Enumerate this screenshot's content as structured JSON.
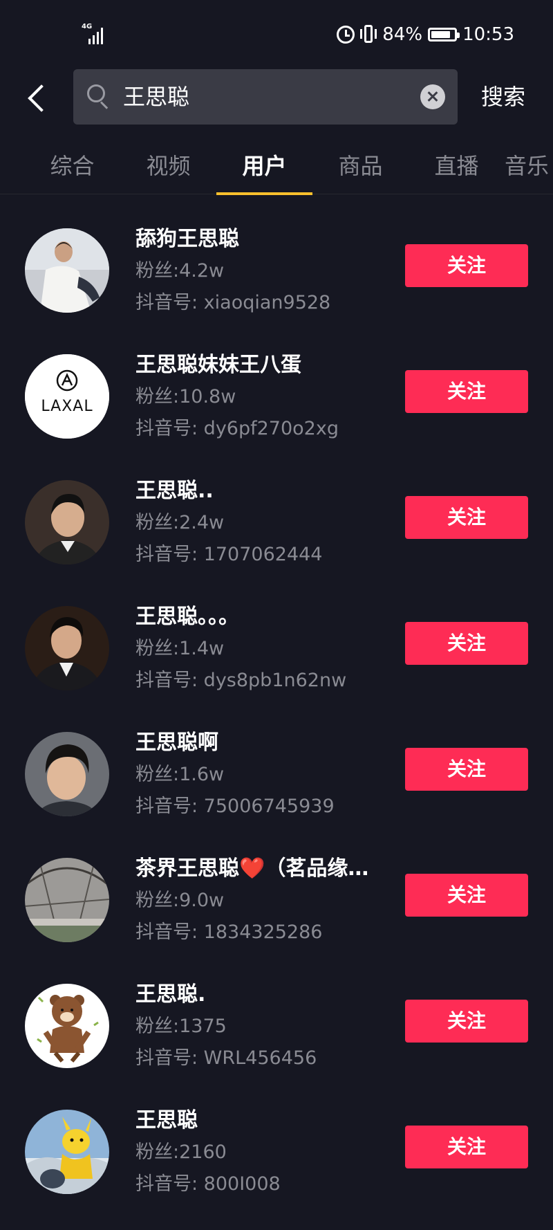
{
  "status_bar": {
    "network": "4G",
    "battery_percent": "84%",
    "battery_level": 0.84,
    "time": "10:53"
  },
  "search": {
    "query": "王思聪",
    "button_label": "搜索"
  },
  "tabs": [
    {
      "label": "综合",
      "active": false
    },
    {
      "label": "视频",
      "active": false
    },
    {
      "label": "用户",
      "active": true
    },
    {
      "label": "商品",
      "active": false
    },
    {
      "label": "直播",
      "active": false
    },
    {
      "label": "音乐",
      "active": false
    }
  ],
  "follow_button_color": "#fe2c55",
  "tab_indicator_color": "#fbc02d",
  "users": [
    {
      "name": "舔狗王思聪",
      "fans": "粉丝:4.2w",
      "id": "抖音号: xiaoqian9528",
      "follow": "关注",
      "avatar": "man-white-shirt-photo"
    },
    {
      "name": "王思聪妹妹王八蛋",
      "fans": "粉丝:10.8w",
      "id": "抖音号: dy6pf270o2xg",
      "follow": "关注",
      "avatar": "laxal-logo",
      "avatar_text": "LAXAL"
    },
    {
      "name": "王思聪..",
      "fans": "粉丝:2.4w",
      "id": "抖音号: 1707062444",
      "follow": "关注",
      "avatar": "man-portrait-photo"
    },
    {
      "name": "王思聪。。。",
      "fans": "粉丝:1.4w",
      "id": "抖音号: dys8pb1n62nw",
      "follow": "关注",
      "avatar": "man-suit-photo"
    },
    {
      "name": "王思聪啊",
      "fans": "粉丝:1.6w",
      "id": "抖音号: 75006745939",
      "follow": "关注",
      "avatar": "man-face-photo"
    },
    {
      "name": "茶界王思聪❤️（茗品缘…",
      "fans": "粉丝:9.0w",
      "id": "抖音号: 1834325286",
      "follow": "关注",
      "avatar": "glass-dome-photo"
    },
    {
      "name": "王思聪.",
      "fans": "粉丝:1375",
      "id": "抖音号: WRL456456",
      "follow": "关注",
      "avatar": "cartoon-bear-icon"
    },
    {
      "name": "王思聪",
      "fans": "粉丝:2160",
      "id": "抖音号: 800I008",
      "follow": "关注",
      "avatar": "yellow-mascot-photo"
    }
  ]
}
